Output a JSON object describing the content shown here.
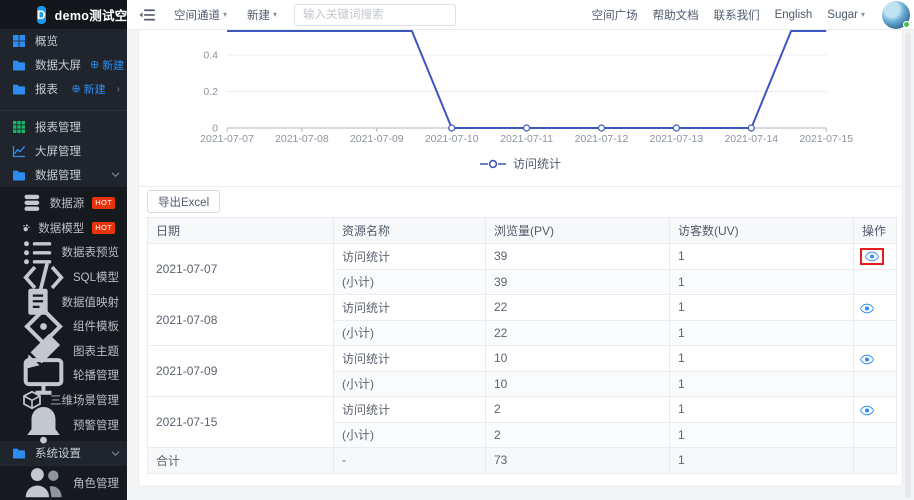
{
  "topbar": {
    "logo_letter": "D",
    "logo_title": "demo测试空间",
    "space_channel": "空间通道",
    "create_new": "新建",
    "search_placeholder": "输入关键词搜索",
    "links": [
      "空间广场",
      "帮助文档",
      "联系我们",
      "English"
    ],
    "username": "Sugar"
  },
  "sidebar": {
    "new_label": "新建",
    "hot_label": "HOT",
    "quick": [
      {
        "label": "概览",
        "icon": "overview-grid-icon"
      },
      {
        "label": "数据大屏",
        "icon": "folder-icon",
        "has_new": true
      },
      {
        "label": "报表",
        "icon": "folder-icon",
        "has_new": true
      }
    ],
    "main": [
      {
        "label": "报表管理",
        "icon": "report-grid-icon"
      },
      {
        "label": "大屏管理",
        "icon": "screen-chart-icon"
      },
      {
        "label": "数据管理",
        "icon": "folder-icon",
        "expanded": true
      }
    ],
    "data_children": [
      {
        "label": "数据源",
        "icon": "database-icon",
        "hot": true
      },
      {
        "label": "数据模型",
        "icon": "model-blob-icon",
        "hot": true
      },
      {
        "label": "数据表预览",
        "icon": "table-list-icon"
      },
      {
        "label": "SQL模型",
        "icon": "code-icon"
      },
      {
        "label": "数据值映射",
        "icon": "mapping-doc-icon"
      },
      {
        "label": "组件模板",
        "icon": "component-diamond-icon"
      },
      {
        "label": "图表主题",
        "icon": "theme-brush-icon"
      },
      {
        "label": "轮播管理",
        "icon": "carousel-monitor-icon"
      },
      {
        "label": "三维场景管理",
        "icon": "cube-icon"
      },
      {
        "label": "预警管理",
        "icon": "alert-bell-icon"
      }
    ],
    "settings": {
      "label": "系统设置",
      "icon": "folder-icon",
      "expanded": true
    },
    "settings_children": [
      {
        "label": "角色管理",
        "icon": "roles-users-icon"
      }
    ]
  },
  "chart_data": {
    "type": "line",
    "x": [
      "2021-07-07",
      "2021-07-08",
      "2021-07-09",
      "2021-07-10",
      "2021-07-11",
      "2021-07-12",
      "2021-07-13",
      "2021-07-14",
      "2021-07-15"
    ],
    "series": [
      {
        "name": "访问统计",
        "values": [
          1,
          1,
          1,
          0,
          0,
          0,
          0,
          0,
          1
        ]
      }
    ],
    "y_ticks_visible": [
      "0",
      "0.2",
      "0.4"
    ],
    "ylim_visible": [
      0,
      0.54
    ],
    "legend": [
      "访问统计"
    ],
    "legend_position": "bottom",
    "grid": true,
    "line_color": "#3e56c0",
    "clipped_top": true
  },
  "table": {
    "export_label": "导出Excel",
    "columns": [
      "日期",
      "资源名称",
      "浏览量(PV)",
      "访客数(UV)",
      "操作"
    ],
    "groups": [
      {
        "date": "2021-07-07",
        "rows": [
          {
            "name": "访问统计",
            "pv": "39",
            "uv": "1"
          },
          {
            "name": "(小计)",
            "pv": "39",
            "uv": "1"
          }
        ]
      },
      {
        "date": "2021-07-08",
        "rows": [
          {
            "name": "访问统计",
            "pv": "22",
            "uv": "1"
          },
          {
            "name": "(小计)",
            "pv": "22",
            "uv": "1"
          }
        ]
      },
      {
        "date": "2021-07-09",
        "rows": [
          {
            "name": "访问统计",
            "pv": "10",
            "uv": "1"
          },
          {
            "name": "(小计)",
            "pv": "10",
            "uv": "1"
          }
        ]
      },
      {
        "date": "2021-07-15",
        "rows": [
          {
            "name": "访问统计",
            "pv": "2",
            "uv": "1"
          },
          {
            "name": "(小计)",
            "pv": "2",
            "uv": "1"
          }
        ]
      }
    ],
    "total": {
      "label": "合计",
      "name": "-",
      "pv": "73",
      "uv": "1"
    }
  },
  "colors": {
    "primary_blue": "#2d8cf0",
    "chart_line": "#3e56c0",
    "hot_red": "#e8340c",
    "annotation_red": "#e11d1d",
    "report_green": "#18b566"
  }
}
